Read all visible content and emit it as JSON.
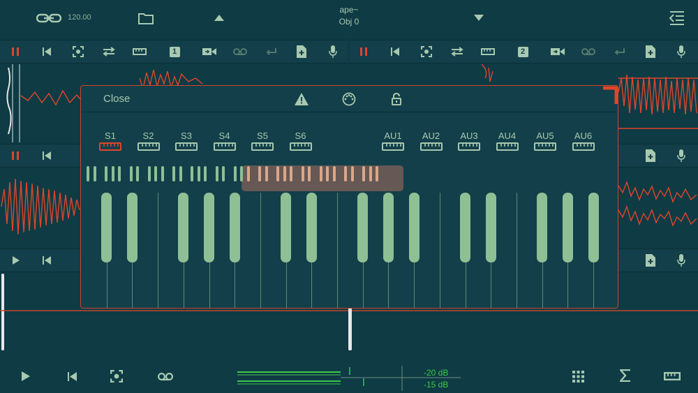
{
  "topbar": {
    "tempo": "120.00",
    "project_name": "ape~",
    "object_name": "Obj 0"
  },
  "tracks": [
    {
      "number": "1"
    },
    {
      "number": "2"
    }
  ],
  "modal": {
    "close_label": "Close",
    "sampler_slots": [
      "S1",
      "S2",
      "S3",
      "S4",
      "S5",
      "S6"
    ],
    "au_slots": [
      "AU1",
      "AU2",
      "AU3",
      "AU4",
      "AU5",
      "AU6"
    ],
    "selected_slot": "S1"
  },
  "meters": {
    "level_1": "-20 dB",
    "level_2": "-15 dB"
  },
  "colors": {
    "background": "#0e3b44",
    "panel": "#123f49",
    "accent_red": "#e0452b",
    "key_green": "#8fbf94",
    "meter_green": "#3ec84a"
  }
}
